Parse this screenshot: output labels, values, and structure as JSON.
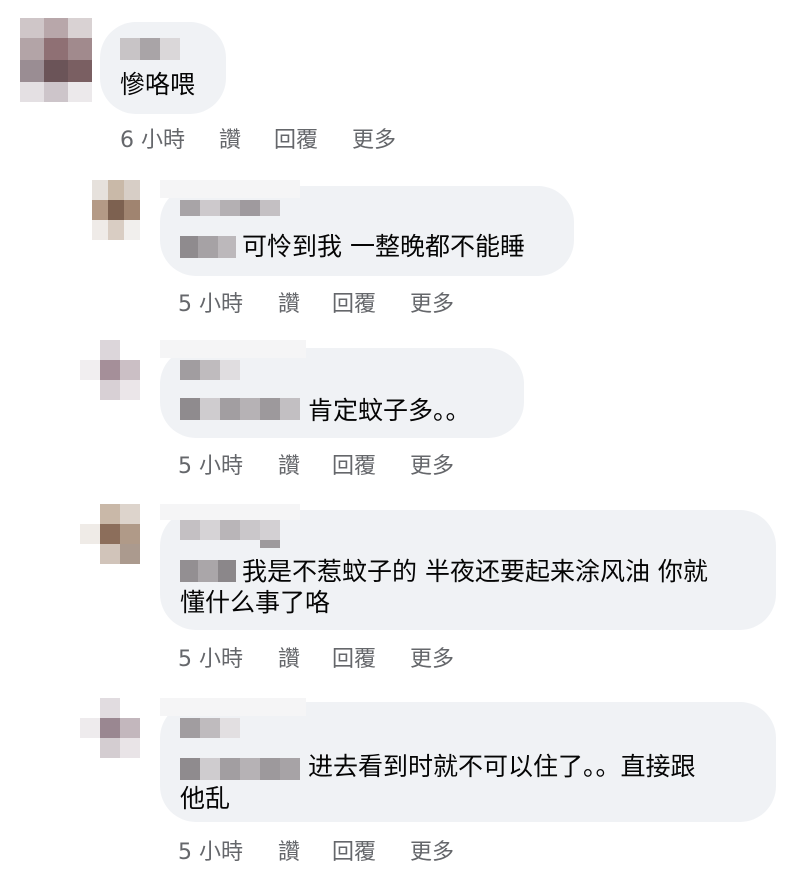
{
  "comments": [
    {
      "text": "慘咯喂",
      "text_line2": "",
      "time": "6 小時",
      "like": "讚",
      "reply": "回覆",
      "more": "更多"
    },
    {
      "text": "可怜到我 一整晚都不能睡",
      "text_line2": "",
      "time": "5 小時",
      "like": "讚",
      "reply": "回覆",
      "more": "更多"
    },
    {
      "text": "肯定蚊子多。。",
      "text_line2": "",
      "time": "5 小時",
      "like": "讚",
      "reply": "回覆",
      "more": "更多"
    },
    {
      "text": "我是不惹蚊子的 半夜还要起来涂风油 你就",
      "text_line2": "懂什么事了咯",
      "time": "5 小時",
      "like": "讚",
      "reply": "回覆",
      "more": "更多"
    },
    {
      "text": "进去看到时就不可以住了。。直接跟",
      "text_line2": "他乱",
      "time": "5 小時",
      "like": "讚",
      "reply": "回覆",
      "more": "更多"
    }
  ],
  "colors": {
    "bubble": "#f0f2f5",
    "text": "#050505",
    "meta": "#65676b"
  }
}
